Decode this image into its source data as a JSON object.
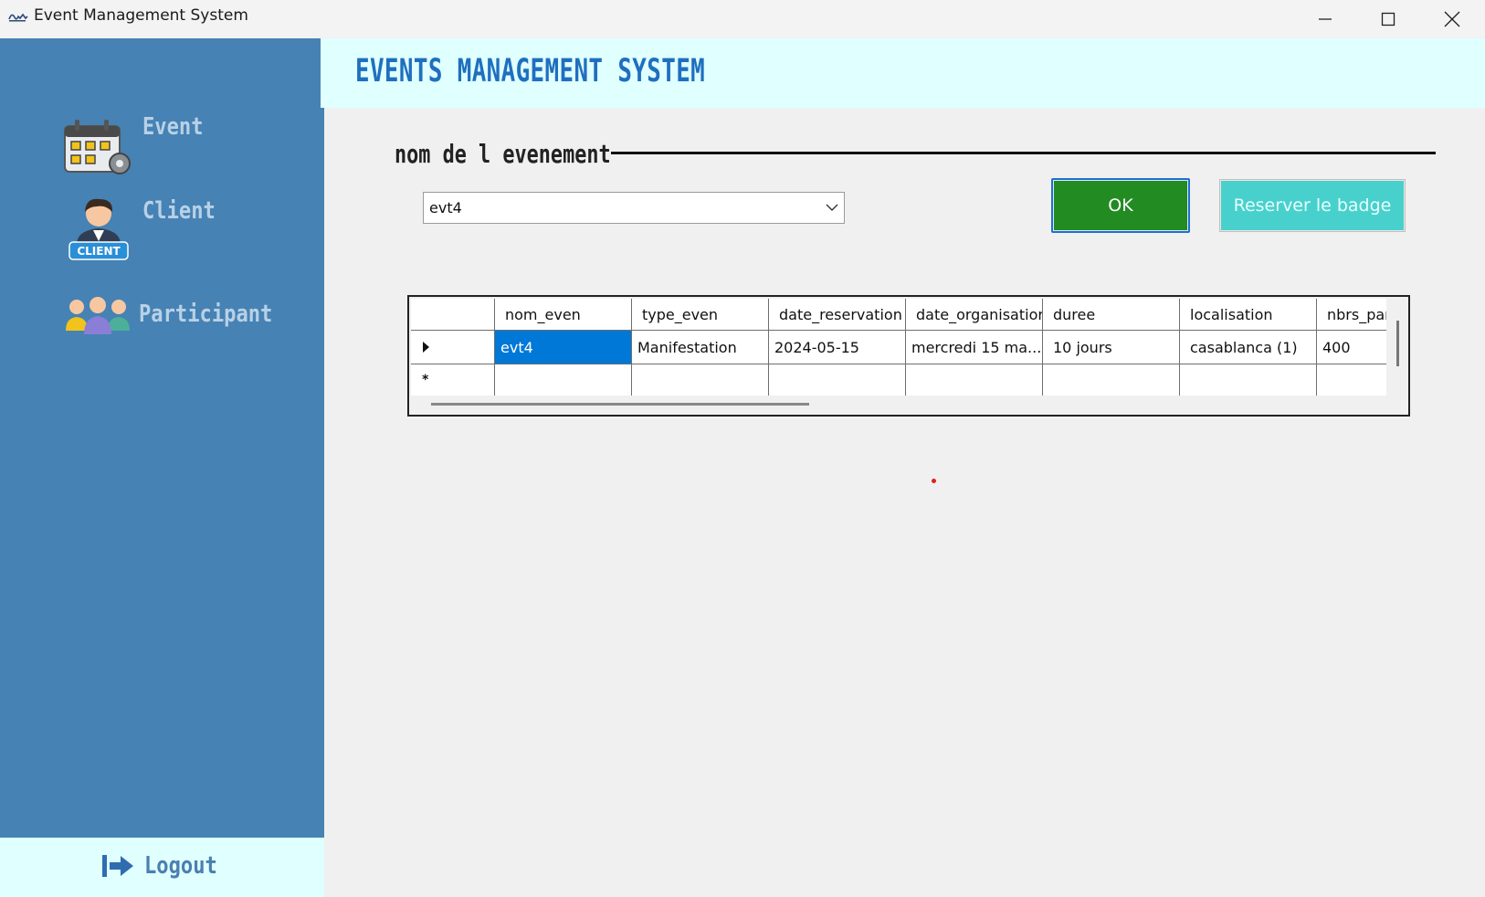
{
  "window": {
    "title": "Event Management System",
    "controls": [
      "minimize-icon",
      "maximize-icon",
      "close-icon"
    ]
  },
  "header": {
    "title": "EVENTS MANAGEMENT SYSTEM"
  },
  "sidebar": {
    "items": [
      {
        "label": "Event",
        "icon": "calendar-gear-icon"
      },
      {
        "label": "Client",
        "icon": "client-avatar-icon"
      },
      {
        "label": "Participant",
        "icon": "people-group-icon"
      }
    ],
    "logout": {
      "label": "Logout",
      "icon": "logout-arrow-icon"
    }
  },
  "form": {
    "group_label": "nom de l evenement",
    "event_select": {
      "value": "evt4"
    },
    "ok_label": "OK",
    "badge_label": "Reserver le badge"
  },
  "grid": {
    "columns": [
      "nom_even",
      "type_even",
      "date_reservation",
      "date_organisatior",
      "duree",
      "localisation",
      "nbrs_par"
    ],
    "rows": [
      [
        "evt4",
        "Manifestation",
        "2024-05-15",
        "mercredi 15 ma...",
        "10 jours",
        "casablanca (1)",
        "400"
      ]
    ],
    "new_row_marker": "*"
  },
  "colors": {
    "sidebar_bg": "#4682b4",
    "header_bg": "#e0ffff",
    "title_color": "#1f6fbf",
    "ok_bg": "#228b22",
    "badge_bg": "#48d1cc",
    "selection": "#0078d7"
  }
}
